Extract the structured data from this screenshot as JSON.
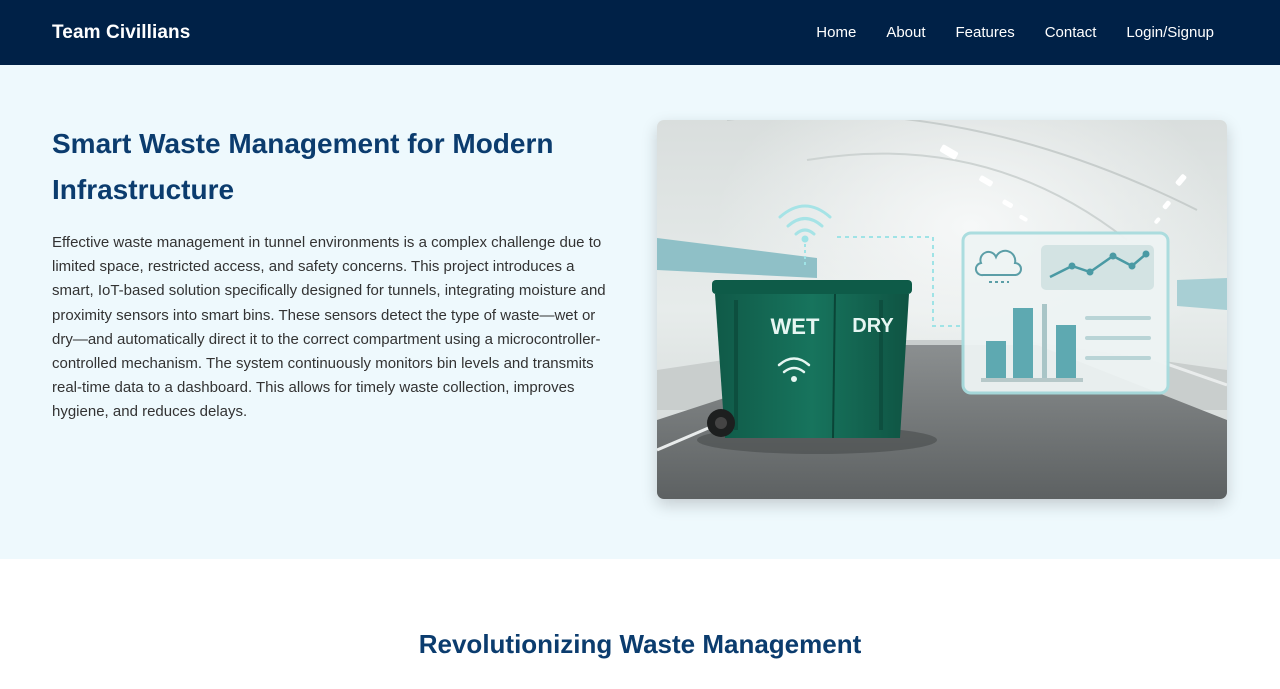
{
  "nav": {
    "brand": "Team Civillians",
    "links": [
      "Home",
      "About",
      "Features",
      "Contact",
      "Login/Signup"
    ]
  },
  "hero": {
    "title": "Smart Waste Management for Modern Infrastructure",
    "description": "Effective waste management in tunnel environments is a complex challenge due to limited space, restricted access, and safety concerns. This project introduces a smart, IoT-based solution specifically designed for tunnels, integrating moisture and proximity sensors into smart bins. These sensors detect the type of waste—wet or dry—and automatically direct it to the correct compartment using a microcontroller-controlled mechanism. The system continuously monitors bin levels and transmits real-time data to a dashboard. This allows for timely waste collection, improves hygiene, and reduces delays.",
    "image": {
      "bin_labels": [
        "WET",
        "DRY"
      ]
    }
  },
  "section2": {
    "title": "Revolutionizing Waste Management"
  },
  "colors": {
    "navbar_bg": "#002147",
    "hero_bg": "#eef9fd",
    "heading": "#0b3c6e",
    "bin_green": "#17745d"
  }
}
